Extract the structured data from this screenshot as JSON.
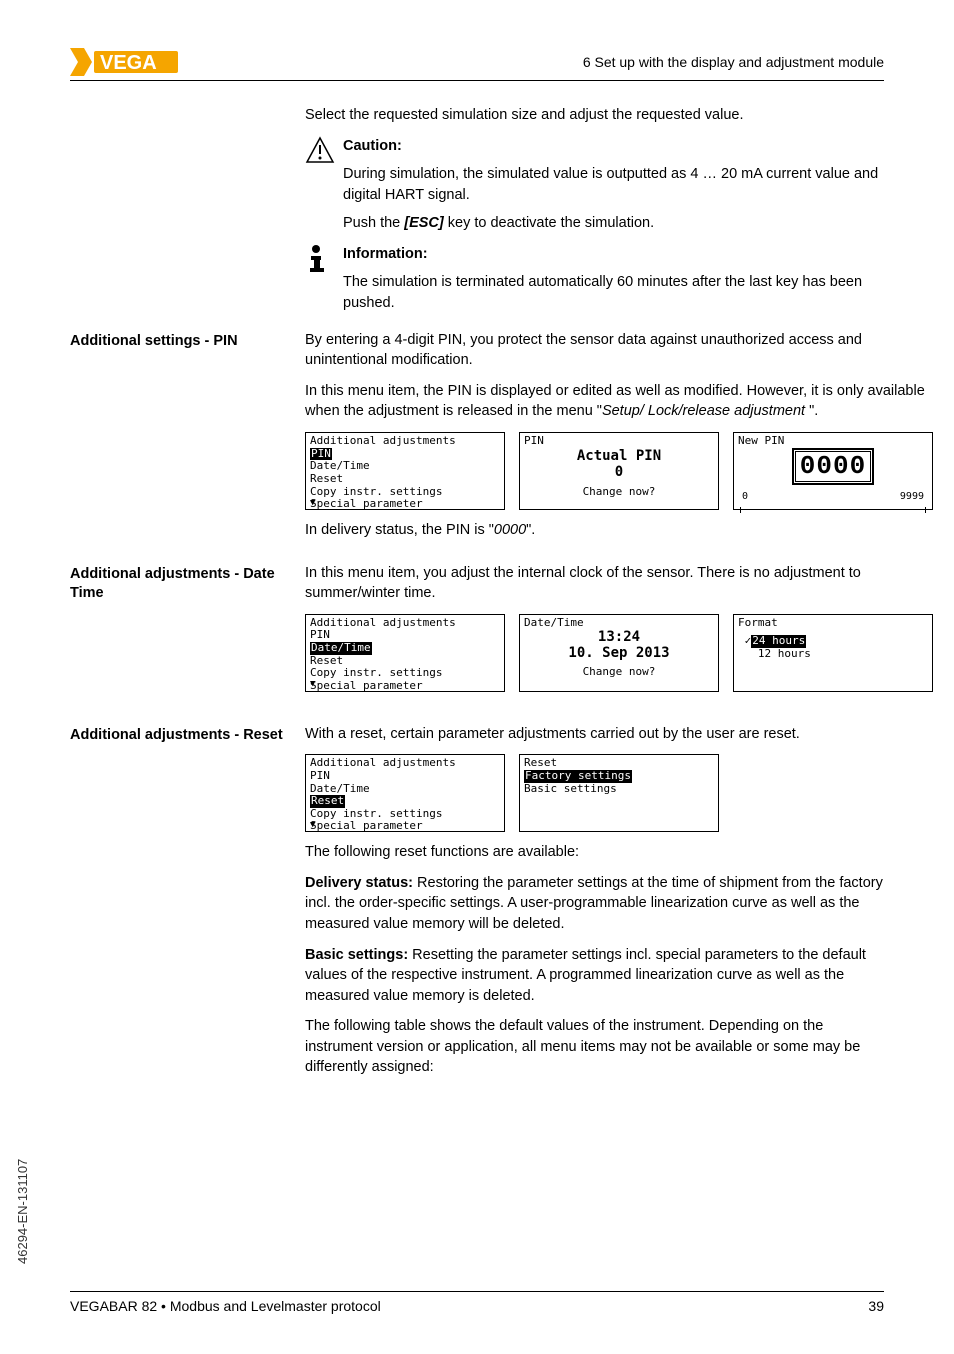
{
  "header": {
    "section": "6 Set up with the display and adjustment module"
  },
  "intro": "Select the requested simulation size and adjust the requested value.",
  "caution": {
    "title": "Caution:",
    "body": "During simulation, the simulated value is outputted as 4 … 20 mA current value and digital HART signal.",
    "after": "Push the [ESC] key to deactivate the simulation.",
    "after_plain_pre": "Push the ",
    "after_key": "[ESC]",
    "after_plain_post": " key to deactivate the simulation."
  },
  "info": {
    "title": "Information:",
    "body": "The simulation is terminated automatically 60 minutes after the last key has been pushed."
  },
  "pin_section": {
    "heading": "Additional settings - PIN",
    "p1": "By entering a 4-digit PIN, you protect the sensor data against unauthorized access and unintentional modification.",
    "p2_pre": "In this menu item, the PIN is displayed or edited as well as modified. However, it is only available when the adjustment is released in the menu \"",
    "p2_em": "Setup/ Lock/release adjustment ",
    "p2_post": "\".",
    "delivery_pre": "In delivery status, the PIN is \"",
    "delivery_em": "0000",
    "delivery_post": "\".",
    "lcd1": {
      "title": "Additional adjustments",
      "items": [
        "PIN",
        "Date/Time",
        "Reset",
        "Copy instr. settings",
        "Special parameter"
      ],
      "selected": 0
    },
    "lcd2": {
      "title": "PIN",
      "line1": "Actual PIN",
      "line2": "0",
      "footer": "Change now?"
    },
    "lcd3": {
      "title": "New PIN",
      "value": "0000",
      "left": "0",
      "right": "9999"
    }
  },
  "datetime_section": {
    "heading": "Additional adjustments - Date Time",
    "p1": "In this menu item, you adjust the internal clock of the sensor. There is no adjustment to summer/winter time.",
    "lcd1": {
      "title": "Additional adjustments",
      "items": [
        "PIN",
        "Date/Time",
        "Reset",
        "Copy instr. settings",
        "Special parameter"
      ],
      "selected": 1
    },
    "lcd2": {
      "title": "Date/Time",
      "line1": "13:24",
      "line2": "10. Sep 2013",
      "footer": "Change now?"
    },
    "lcd3": {
      "title": "Format",
      "opt1": "24 hours",
      "opt2": "12 hours"
    }
  },
  "reset_section": {
    "heading": "Additional adjustments - Reset",
    "p1": "With a reset, certain parameter adjustments carried out by the user are reset.",
    "lcd1": {
      "title": "Additional adjustments",
      "items": [
        "PIN",
        "Date/Time",
        "Reset",
        "Copy instr. settings",
        "Special parameter"
      ],
      "selected": 2
    },
    "lcd2": {
      "title": "Reset",
      "opt1": "Factory settings",
      "opt2": "Basic settings"
    },
    "p2": "The following reset functions are available:",
    "p3_b": "Delivery status: ",
    "p3": "Restoring the parameter settings at the time of shipment from the factory incl. the order-specific settings. A user-programmable linearization curve as well as the measured value memory will be deleted.",
    "p4_b": "Basic settings: ",
    "p4": "Resetting the parameter settings incl. special parameters to the default values of the respective instrument. A programmed linearization curve as well as the measured value memory is deleted.",
    "p5": "The following table shows the default values of the instrument. Depending on the instrument version or application, all menu items may not be available or some may be differently assigned:"
  },
  "sidetext": "46294-EN-131107",
  "footer": {
    "left": "VEGABAR 82 • Modbus and Levelmaster protocol",
    "right": "39"
  },
  "chart_data": {
    "type": "table",
    "note": "No chart present; document page."
  }
}
